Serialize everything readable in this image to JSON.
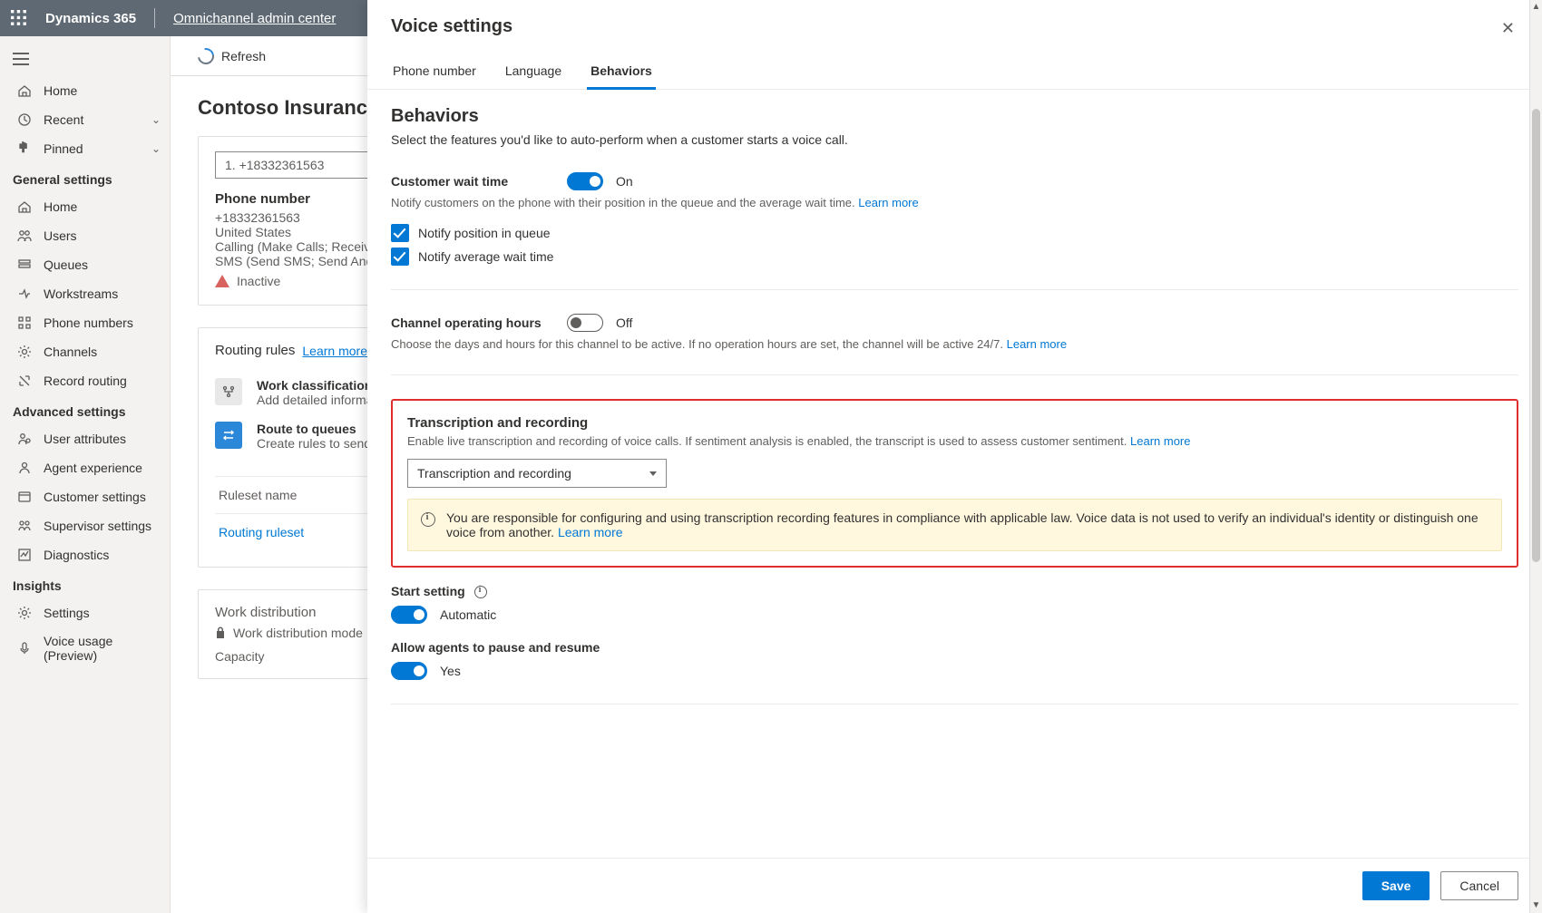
{
  "topbar": {
    "app_name": "Dynamics 365",
    "context_link": "Omnichannel admin center"
  },
  "commandbar": {
    "refresh": "Refresh"
  },
  "leftnav": {
    "top_items": [
      {
        "icon": "home",
        "label": "Home"
      },
      {
        "icon": "clock",
        "label": "Recent",
        "chev": true
      },
      {
        "icon": "pin",
        "label": "Pinned",
        "chev": true
      }
    ],
    "general_title": "General settings",
    "general_items": [
      {
        "icon": "home",
        "label": "Home"
      },
      {
        "icon": "users",
        "label": "Users"
      },
      {
        "icon": "queues",
        "label": "Queues"
      },
      {
        "icon": "work",
        "label": "Workstreams"
      },
      {
        "icon": "phone",
        "label": "Phone numbers"
      },
      {
        "icon": "gear",
        "label": "Channels"
      },
      {
        "icon": "route",
        "label": "Record routing"
      }
    ],
    "advanced_title": "Advanced settings",
    "advanced_items": [
      {
        "icon": "userattr",
        "label": "User attributes"
      },
      {
        "icon": "agent",
        "label": "Agent experience"
      },
      {
        "icon": "cust",
        "label": "Customer settings"
      },
      {
        "icon": "superv",
        "label": "Supervisor settings"
      },
      {
        "icon": "diag",
        "label": "Diagnostics"
      }
    ],
    "insights_title": "Insights",
    "insights_items": [
      {
        "icon": "gear",
        "label": "Settings"
      },
      {
        "icon": "voice",
        "label": "Voice usage (Preview)"
      }
    ]
  },
  "main": {
    "page_title": "Contoso Insurance voi",
    "phone_select": "1. +18332361563",
    "phone_card": {
      "header": "Phone number",
      "number": "+18332361563",
      "country": "United States",
      "calling": "Calling (Make Calls; Receive",
      "sms": "SMS (Send SMS; Send And",
      "status": "Inactive"
    },
    "routing": {
      "title": "Routing rules",
      "learn_more": "Learn more",
      "rows": [
        {
          "blue": false,
          "title": "Work classification (opt",
          "sub": "Add detailed information to"
        },
        {
          "blue": true,
          "title": "Route to queues",
          "sub": "Create rules to send incom"
        }
      ],
      "ruleset_col": "Ruleset name",
      "ruleset_value": "Routing ruleset"
    },
    "work_dist": {
      "title": "Work distribution",
      "mode": "Work distribution mode",
      "capacity": "Capacity"
    }
  },
  "panel": {
    "title": "Voice settings",
    "tabs": [
      "Phone number",
      "Language",
      "Behaviors"
    ],
    "active_tab": 2,
    "behaviors": {
      "heading": "Behaviors",
      "subheading": "Select the features you'd like to auto-perform when a customer starts a voice call.",
      "wait": {
        "label": "Customer wait time",
        "state": "On",
        "help": "Notify customers on the phone with their position in the queue and the average wait time.",
        "learn_more": "Learn more",
        "cb1": "Notify position in queue",
        "cb2": "Notify average wait time"
      },
      "hours": {
        "label": "Channel operating hours",
        "state": "Off",
        "help": "Choose the days and hours for this channel to be active. If no operation hours are set, the channel will be active 24/7.",
        "learn_more": "Learn more"
      },
      "trans": {
        "label": "Transcription and recording",
        "help": "Enable live transcription and recording of voice calls. If sentiment analysis is enabled, the transcript is used to assess customer sentiment.",
        "learn_more": "Learn more",
        "dropdown": "Transcription and recording",
        "banner": "You are responsible for configuring and using transcription recording features in compliance with applicable law. Voice data is not used to verify an individual's identity or distinguish one voice from another.",
        "banner_learn_more": "Learn more"
      },
      "start": {
        "label": "Start setting",
        "state": "Automatic"
      },
      "pause": {
        "label": "Allow agents to pause and resume",
        "state": "Yes"
      }
    },
    "footer": {
      "save": "Save",
      "cancel": "Cancel"
    }
  }
}
